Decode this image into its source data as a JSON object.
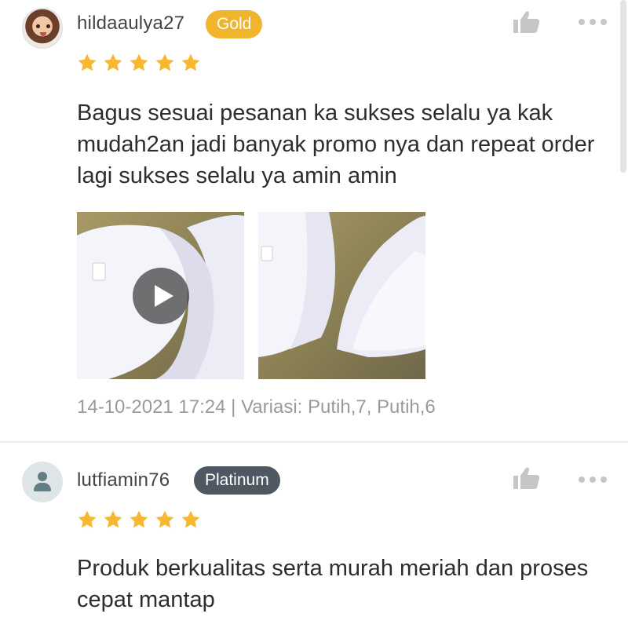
{
  "reviews": [
    {
      "username": "hildaaulya27",
      "badge": "Gold",
      "rating": 5,
      "text": "Bagus sesuai pesanan ka sukses selalu ya kak mudah2an jadi banyak promo nya dan repeat order lagi sukses selalu ya amin amin",
      "date": "14-10-2021 17:24",
      "separator": "|",
      "variation": "Variasi: Putih,7, Putih,6",
      "media": [
        {
          "type": "video",
          "icon": "play-icon"
        },
        {
          "type": "image"
        }
      ]
    },
    {
      "username": "lutfiamin76",
      "badge": "Platinum",
      "rating": 5,
      "text": "Produk berkualitas serta murah meriah dan proses cepat mantap"
    }
  ],
  "icons": {
    "like": "thumbs-up-icon",
    "more": "more-options-icon",
    "star": "star-icon",
    "default_avatar": "person-icon"
  },
  "colors": {
    "star": "#f7b731",
    "gold_badge": "#f0b52c",
    "platinum_badge": "#4f5763",
    "meta_text": "#9a9a9a",
    "icon_gray": "#c6c6c6"
  }
}
